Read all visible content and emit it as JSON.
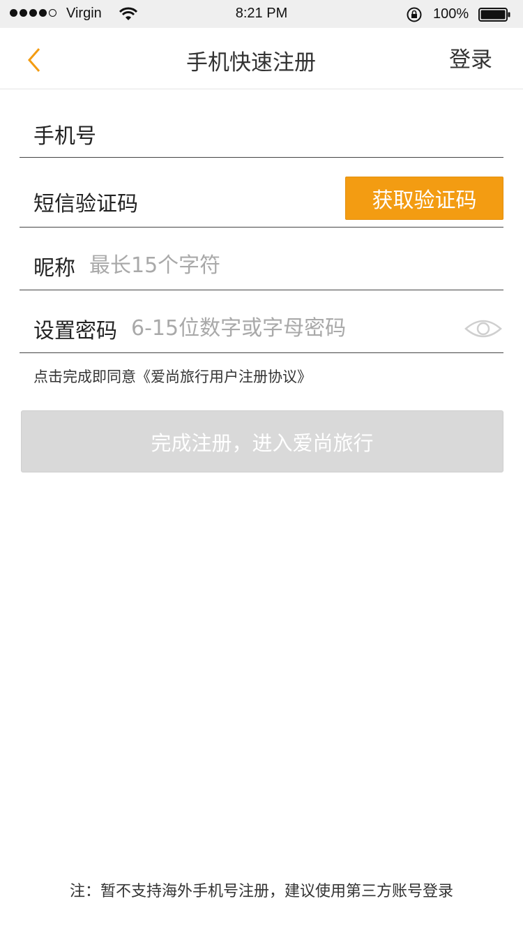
{
  "status_bar": {
    "carrier": "Virgin",
    "time": "8:21 PM",
    "battery": "100%"
  },
  "nav": {
    "title": "手机快速注册",
    "right_link": "登录",
    "accent_color": "#f39c12"
  },
  "form": {
    "phone_label": "手机号",
    "code_label": "短信验证码",
    "code_button": "获取验证码",
    "nickname_label": "昵称",
    "nickname_placeholder": "最长15个字符",
    "password_label": "设置密码",
    "password_placeholder": "6-15位数字或字母密码"
  },
  "agreement": {
    "prefix": "点击完成即同意",
    "protocol": "《爱尚旅行用户注册协议》"
  },
  "submit_label": "完成注册，进入爱尚旅行",
  "footer_note": "注：暂不支持海外手机号注册，建议使用第三方账号登录"
}
